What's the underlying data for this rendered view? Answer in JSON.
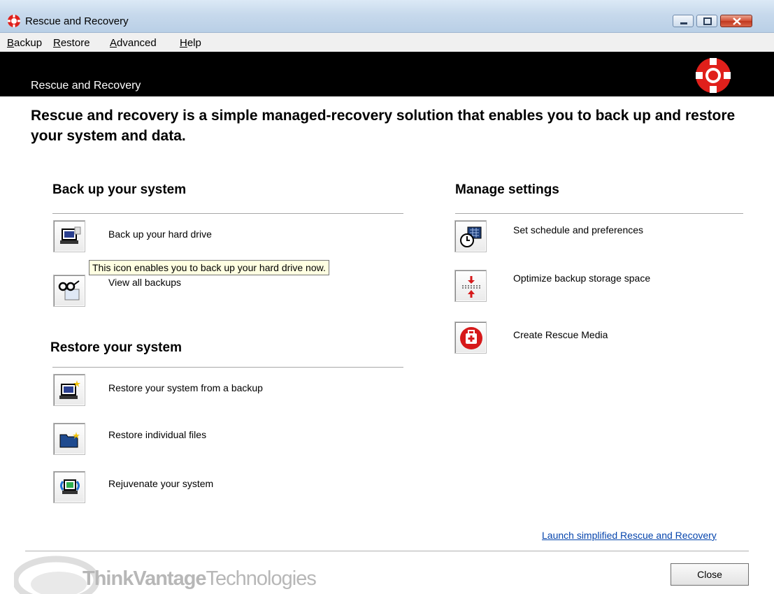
{
  "window": {
    "title": "Rescue and Recovery"
  },
  "menu": [
    {
      "label": "Backup",
      "accel": "B",
      "rest": "ackup"
    },
    {
      "label": "Restore",
      "accel": "R",
      "rest": "estore"
    },
    {
      "label": "Advanced",
      "accel": "A",
      "rest": "dvanced"
    },
    {
      "label": "Help",
      "accel": "H",
      "rest": "elp"
    }
  ],
  "banner": {
    "title": "Rescue and Recovery"
  },
  "headline": "Rescue and recovery is a simple managed-recovery solution that enables you to back up and restore your system and data.",
  "sections": {
    "backup": {
      "title": "Back up your system",
      "items": [
        {
          "label": "Back up your hard drive",
          "icon": "laptop-backup-icon"
        },
        {
          "label": "View all backups",
          "icon": "glasses-icon"
        }
      ]
    },
    "restore": {
      "title": "Restore your system",
      "items": [
        {
          "label": "Restore your system from a backup",
          "icon": "laptop-restore-icon"
        },
        {
          "label": "Restore individual files",
          "icon": "folder-restore-icon"
        },
        {
          "label": "Rejuvenate your system",
          "icon": "rejuvenate-icon"
        }
      ]
    },
    "manage": {
      "title": "Manage settings",
      "items": [
        {
          "label": "Set schedule and preferences",
          "icon": "schedule-icon"
        },
        {
          "label": "Optimize backup storage space",
          "icon": "optimize-storage-icon"
        },
        {
          "label": "Create Rescue Media",
          "icon": "rescue-media-icon"
        }
      ]
    }
  },
  "tooltip": "This icon enables you to back up your hard drive now.",
  "footer": {
    "link": "Launch simplified Rescue and Recovery",
    "brand": "ThinkVantage Technologies",
    "brand_bold": "ThinkVantage",
    "brand_light": "Technologies",
    "close_label": "Close"
  },
  "colors": {
    "banner": "#000000",
    "link": "#0645ad",
    "tooltip_bg": "#ffffe1",
    "brand_red": "#e0201b"
  }
}
